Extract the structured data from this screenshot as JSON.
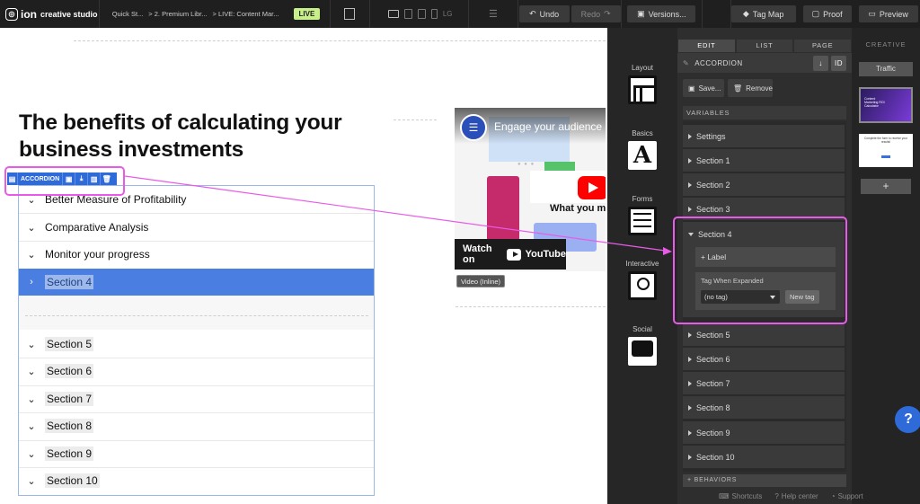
{
  "app": {
    "logo_text": "ion",
    "logo_sub": "creative studio",
    "live_badge": "LIVE"
  },
  "breadcrumb": [
    "Quick St...",
    "> 2. Premium Libr...",
    "> LIVE: Content Mar..."
  ],
  "toolbar": {
    "undo": "Undo",
    "redo": "Redo",
    "versions": "Versions...",
    "tag_map": "Tag Map",
    "proof": "Proof",
    "preview": "Preview",
    "lg": "LG"
  },
  "canvas": {
    "headline": "The benefits of calculating your business investments",
    "accordion_tag": "ACCORDION",
    "sections": [
      {
        "label": "Better Measure of Profitability"
      },
      {
        "label": "Comparative Analysis"
      },
      {
        "label": "Monitor your progress"
      },
      {
        "label": "Section 4"
      },
      {
        "label": "Section 5"
      },
      {
        "label": "Section 6"
      },
      {
        "label": "Section 7"
      },
      {
        "label": "Section 8"
      },
      {
        "label": "Section 9"
      },
      {
        "label": "Section 10"
      }
    ],
    "video": {
      "title": "Engage your audience",
      "caption": "What you m",
      "watch_on": "Watch on",
      "youtube": "YouTube",
      "label": "Video (Inline)"
    }
  },
  "tools": [
    {
      "label": "Layout"
    },
    {
      "label": "Basics"
    },
    {
      "label": "Forms"
    },
    {
      "label": "Interactive"
    },
    {
      "label": "Social"
    }
  ],
  "panel": {
    "tabs": [
      "EDIT",
      "LIST",
      "PAGE"
    ],
    "component": "ACCORDION",
    "id_btn": "ID",
    "save": "Save...",
    "remove": "Remove",
    "variables": "VARIABLES",
    "items": [
      "Settings",
      "Section 1",
      "Section 2",
      "Section 3"
    ],
    "expanded": {
      "title": "Section 4",
      "add_label": "+ Label",
      "tag_when": "Tag When Expanded",
      "select_value": "(no tag)",
      "new_tag": "New tag"
    },
    "items_after": [
      "Section 5",
      "Section 6",
      "Section 7",
      "Section 8",
      "Section 9",
      "Section 10"
    ],
    "behaviors": "+ BEHAVIORS"
  },
  "creative": {
    "title": "CREATIVE",
    "traffic": "Traffic",
    "add": "+",
    "thumb1_text": "Content Marketing ROI Calculator",
    "thumb2_text": "Complete the form to receive your results!"
  },
  "help": "?",
  "footer": {
    "shortcuts": "Shortcuts",
    "help_center": "Help center",
    "support": "Support"
  },
  "colors": {
    "accent": "#2f6ad9",
    "highlight": "#e85be8",
    "live": "#c8f08a"
  }
}
